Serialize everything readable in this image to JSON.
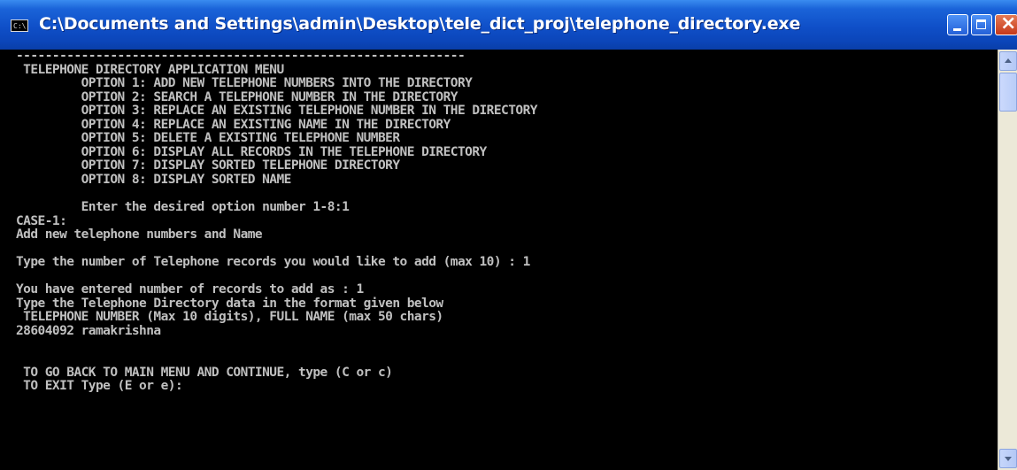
{
  "window": {
    "title": "C:\\Documents and Settings\\admin\\Desktop\\tele_dict_proj\\telephone_directory.exe",
    "icon": "console-app-icon",
    "icon_text": "C:\\"
  },
  "console": {
    "lines": [
      "--------------------------------------------------------------",
      " TELEPHONE DIRECTORY APPLICATION MENU",
      "         OPTION 1: ADD NEW TELEPHONE NUMBERS INTO THE DIRECTORY",
      "         OPTION 2: SEARCH A TELEPHONE NUMBER IN THE DIRECTORY",
      "         OPTION 3: REPLACE AN EXISTING TELEPHONE NUMBER IN THE DIRECTORY",
      "         OPTION 4: REPLACE AN EXISTING NAME IN THE DIRECTORY",
      "         OPTION 5: DELETE A EXISTING TELEPHONE NUMBER",
      "         OPTION 6: DISPLAY ALL RECORDS IN THE TELEPHONE DIRECTORY",
      "         OPTION 7: DISPLAY SORTED TELEPHONE DIRECTORY",
      "         OPTION 8: DISPLAY SORTED NAME",
      "",
      "         Enter the desired option number 1-8:1",
      "CASE-1:",
      "Add new telephone numbers and Name",
      "",
      "Type the number of Telephone records you would like to add (max 10) : 1",
      "",
      "You have entered number of records to add as : 1",
      "Type the Telephone Directory data in the format given below",
      " TELEPHONE NUMBER (Max 10 digits), FULL NAME (max 50 chars)",
      "28604092 ramakrishna",
      "",
      "",
      " TO GO BACK TO MAIN MENU AND CONTINUE, type (C or c)",
      " TO EXIT Type (E or e):"
    ]
  },
  "controls": {
    "minimize": "minimize-icon",
    "maximize": "maximize-icon",
    "close": "close-icon"
  },
  "colors": {
    "titlebar": "#0f4fc8",
    "console_bg": "#000000",
    "console_text": "#c0c0c0"
  }
}
